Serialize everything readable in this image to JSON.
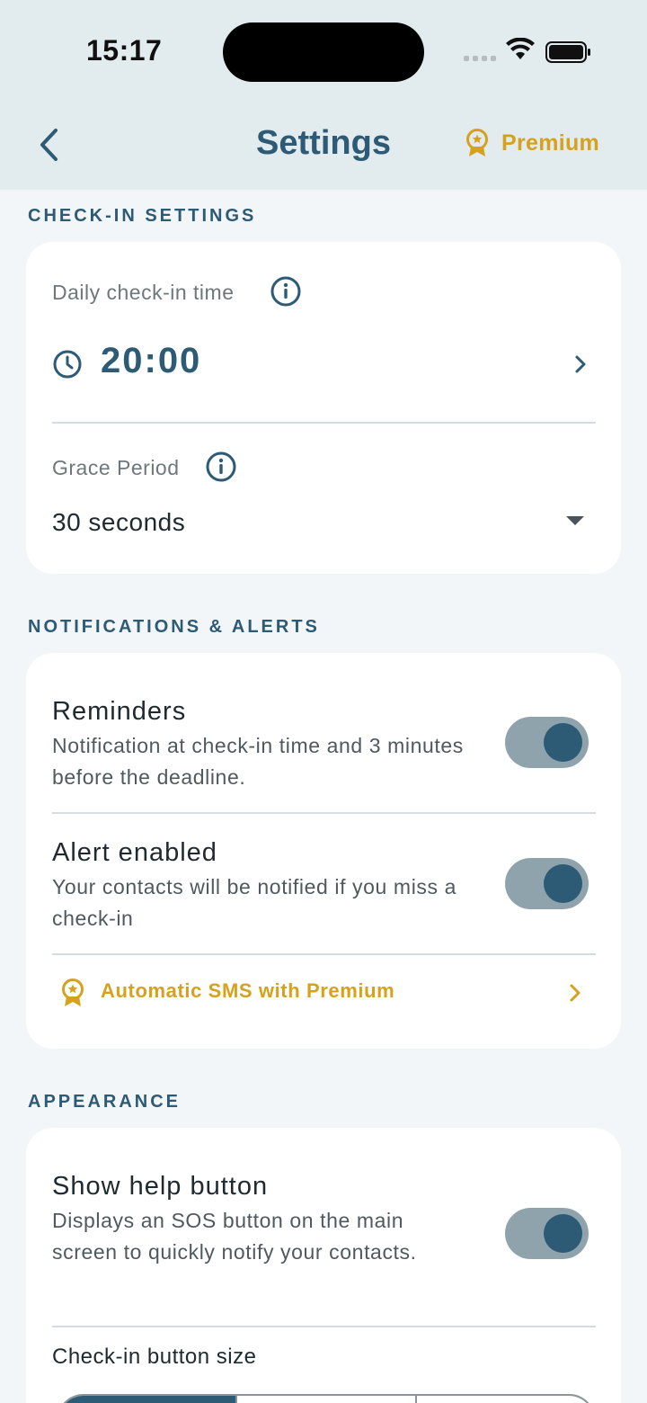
{
  "status_bar": {
    "time": "15:17"
  },
  "nav": {
    "title": "Settings",
    "premium_label": "Premium"
  },
  "sections": {
    "checkin": {
      "header": "CHECK-IN SETTINGS",
      "daily_time_label": "Daily check-in time",
      "daily_time_value": "20:00",
      "grace_label": "Grace Period",
      "grace_value": "30 seconds"
    },
    "notifications": {
      "header": "NOTIFICATIONS & ALERTS",
      "reminders_title": "Reminders",
      "reminders_desc": "Notification at check-in time and 3 minutes before the deadline.",
      "reminders_on": true,
      "alert_title": "Alert enabled",
      "alert_desc": "Your contacts will be notified if you miss a check-in",
      "alert_on": true,
      "sms_label": "Automatic SMS with Premium"
    },
    "appearance": {
      "header": "APPEARANCE",
      "help_title": "Show help button",
      "help_desc": "Displays an SOS button on the main screen to quickly notify your contacts.",
      "help_on": true,
      "size_label": "Check-in button size"
    }
  },
  "colors": {
    "accent": "#2d5a74",
    "premium": "#d6a21e",
    "toggle_track": "#8fa3ad",
    "header_bg": "#e2ebee"
  },
  "icons": [
    "back-chevron-icon",
    "premium-badge-icon",
    "info-icon",
    "clock-icon",
    "chevron-right-icon",
    "dropdown-caret-icon"
  ]
}
